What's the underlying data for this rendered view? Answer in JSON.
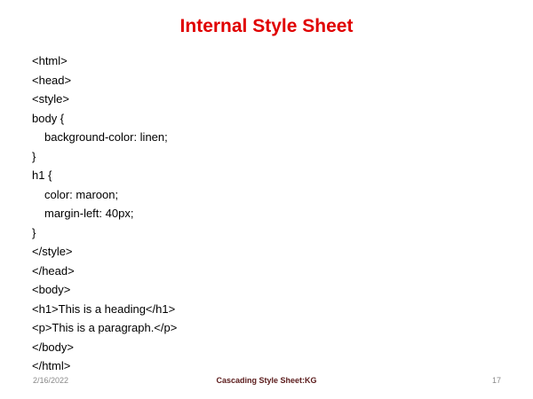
{
  "slide": {
    "title": "Internal Style Sheet",
    "code_lines": [
      "<html>",
      "<head>",
      "<style>",
      "body {",
      "background-color: linen;",
      "}",
      "h1 {",
      "color: maroon;",
      "margin-left: 40px;",
      "}",
      "</style>",
      "</head>",
      "<body>",
      "<h1>This is a heading</h1>",
      "<p>This is a paragraph.</p>",
      "</body>",
      "</html>"
    ],
    "footer": {
      "date": "2/16/2022",
      "center": "Cascading  Style Sheet:KG",
      "page": "17"
    }
  },
  "colors": {
    "title": "#e00000",
    "footer_center": "#5a1a1a",
    "footer_muted": "#8a8a8a"
  }
}
